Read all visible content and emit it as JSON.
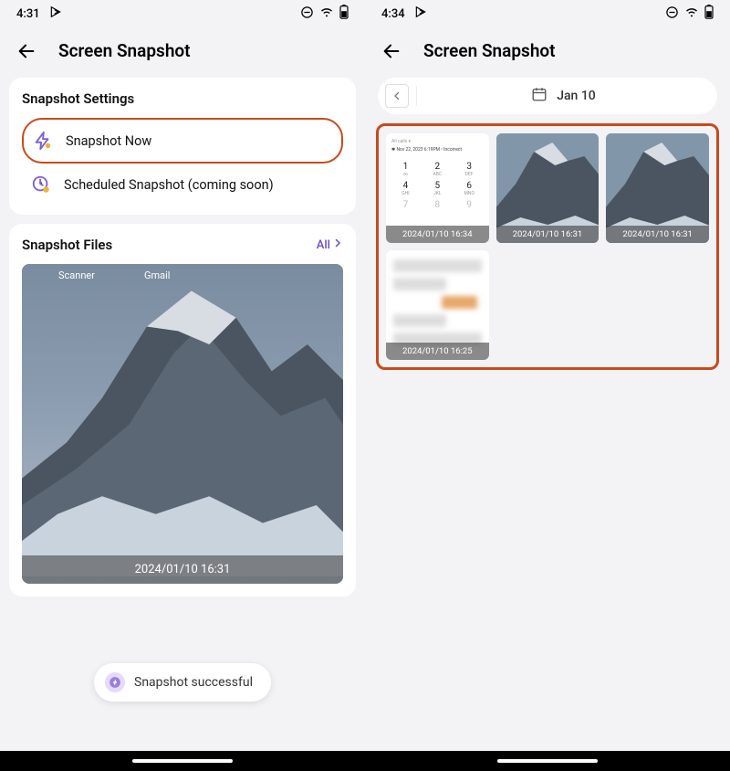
{
  "left": {
    "status_time": "4:31",
    "page_title": "Screen Snapshot",
    "settings_title": "Snapshot Settings",
    "opt_now": "Snapshot Now",
    "opt_sched": "Scheduled Snapshot (coming soon)",
    "files_title": "Snapshot Files",
    "all_label": "All",
    "big_ts": "2024/01/10 16:31",
    "icon1": "Scanner",
    "icon2": "Gmail",
    "toast": "Snapshot successful"
  },
  "right": {
    "status_time": "4:34",
    "page_title": "Screen Snapshot",
    "date_label": "Jan 10",
    "thumbs": [
      {
        "ts": "2024/01/10 16:34"
      },
      {
        "ts": "2024/01/10 16:31"
      },
      {
        "ts": "2024/01/10 16:31"
      },
      {
        "ts": "2024/01/10 16:25"
      }
    ],
    "dialer_top": "Nov 22, 2023 6:19PM • Incorrect"
  }
}
